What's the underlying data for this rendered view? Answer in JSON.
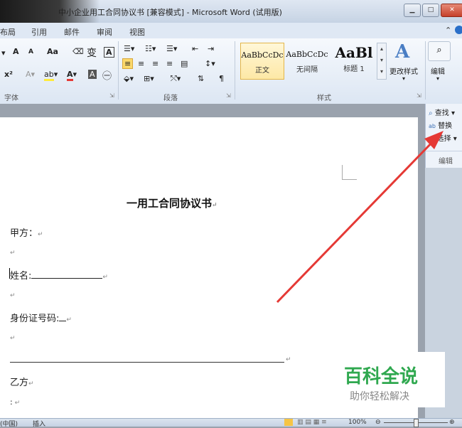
{
  "window": {
    "title": "中小企业用工合同协议书 [兼容模式] - Microsoft Word (试用版)",
    "minimize": "▁",
    "maximize": "□",
    "close": "✕"
  },
  "tabs": [
    "布局",
    "引用",
    "邮件",
    "审阅",
    "视图"
  ],
  "ribbon": {
    "font_group_label": "字体",
    "paragraph_group_label": "段落",
    "styles_group_label": "样式",
    "edit_group_label": "编辑",
    "font_grow": "A",
    "font_shrink": "A",
    "change_case": "Aa",
    "phonetic": "ᵃᵇᶜ",
    "char_border": "A",
    "styles": [
      {
        "sample": "AaBbCcDc",
        "name": "正文"
      },
      {
        "sample": "AaBbCcDc",
        "name": "无间隔"
      },
      {
        "sample": "AaBl",
        "name": "标题 1"
      }
    ],
    "change_styles": "更改样式",
    "edit_button": "编辑"
  },
  "edit_panel": {
    "find": "查找",
    "replace": "替换",
    "select": "选择",
    "label": "编辑"
  },
  "document": {
    "heading": "一用工合同协议书",
    "party_a": "甲方：",
    "name": "姓名:",
    "id_number": "身份证号码:",
    "party_b": "乙方",
    "colon_line": ":"
  },
  "statusbar": {
    "lang": "(中国)",
    "mode": "插入",
    "zoom": "100%"
  },
  "watermark": {
    "title": "百科全说",
    "subtitle": "助你轻松解决"
  },
  "colors": {
    "arrow": "#e53935",
    "watermark_green": "#2fa84f"
  }
}
